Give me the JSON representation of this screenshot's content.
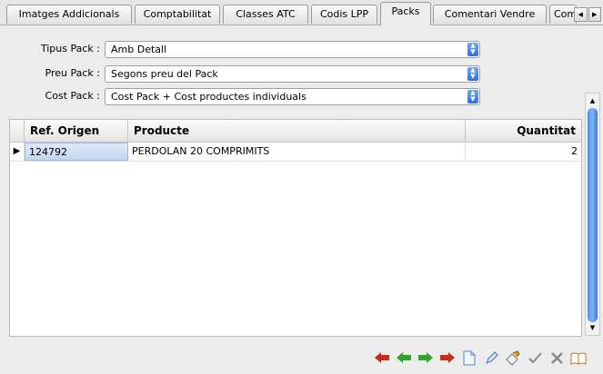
{
  "tabs": [
    {
      "label": "Imatges Addicionals",
      "active": false
    },
    {
      "label": "Comptabilitat",
      "active": false
    },
    {
      "label": "Classes ATC",
      "active": false
    },
    {
      "label": "Codis LPP",
      "active": false
    },
    {
      "label": "Packs",
      "active": true
    },
    {
      "label": "Comentari Vendre",
      "active": false
    },
    {
      "label": "Com",
      "active": false
    }
  ],
  "form": {
    "tipus_label": "Tipus Pack :",
    "tipus_value": "Amb Detall",
    "preu_label": "Preu Pack :",
    "preu_value": "Segons preu del Pack",
    "cost_label": "Cost Pack :",
    "cost_value": "Cost Pack + Cost productes individuals"
  },
  "grid": {
    "headers": [
      "Ref. Origen",
      "Producte",
      "Quantitat"
    ],
    "rows": [
      {
        "ref": "124792",
        "producte": "PERDOLAN 20 COMPRIMITS",
        "quantitat": "2"
      }
    ]
  },
  "icons": {
    "arrow_red": "#cc2a1a",
    "arrow_green": "#2fa52f"
  }
}
